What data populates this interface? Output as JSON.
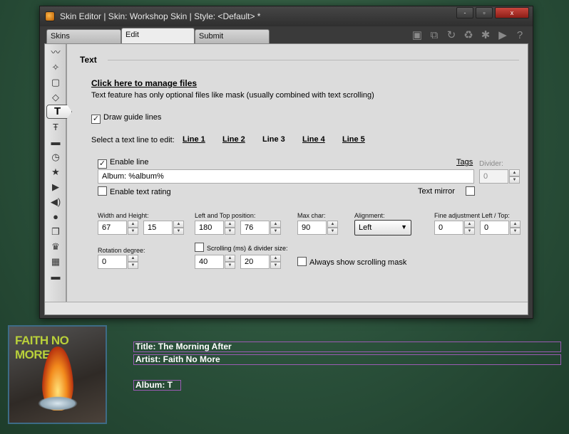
{
  "window": {
    "title": "Skin Editor | Skin: Workshop Skin | Style: <Default> *",
    "min_label": "-",
    "max_label": "▫",
    "close_label": "x"
  },
  "tabs": [
    {
      "label": "Skins"
    },
    {
      "label": "Edit"
    },
    {
      "label": "Submit"
    }
  ],
  "toolbar_icons": [
    "save-icon",
    "copy-icon",
    "redo-icon",
    "recycle-icon",
    "asterisk-icon",
    "play-icon",
    "help-icon"
  ],
  "sidebar_icons": [
    "mustache-icon",
    "star-shape-icon",
    "rectangle-icon",
    "diamond-icon",
    "text-icon",
    "text-scroll-icon",
    "bar-icon",
    "clock-icon",
    "star-icon",
    "play-icon",
    "speaker-icon",
    "speech-bubble-icon",
    "layers-icon",
    "crown-icon",
    "grid-icon",
    "line-icon"
  ],
  "section": {
    "title": "Text",
    "manage_link": "Click here to manage files",
    "description": "Text feature has only optional files like mask (usually combined with text scrolling)",
    "draw_guide_label": "Draw guide lines",
    "select_line_label": "Select a text line to edit:",
    "lines": [
      "Line 1",
      "Line 2",
      "Line 3",
      "Line 4",
      "Line 5"
    ],
    "enable_line_label": "Enable line",
    "tags_label": "Tags",
    "divider_label": "Divider:",
    "divider_value": "0",
    "text_value": "Album: %album%",
    "enable_rating_label": "Enable text rating",
    "text_mirror_label": "Text mirror",
    "width_height_label": "Width and Height:",
    "width_value": "67",
    "height_value": "15",
    "position_label": "Left and Top position:",
    "left_value": "180",
    "top_value": "76",
    "max_char_label": "Max char:",
    "max_char_value": "90",
    "alignment_label": "Alignment:",
    "alignment_value": "Left",
    "fine_adjust_label": "Fine adjustment Left / Top:",
    "fine_left_value": "0",
    "fine_top_value": "0",
    "rotation_label": "Rotation degree:",
    "rotation_value": "0",
    "scrolling_label": "Scrolling (ms) & divider size:",
    "scroll_ms_value": "40",
    "scroll_divider_value": "20",
    "always_scroll_label": "Always show scrolling mask"
  },
  "player": {
    "album_art_text": "FAITH NO MORE",
    "title_line": "Title: The Morning After",
    "artist_line": "Artist: Faith No More",
    "album_line": "Album: T"
  },
  "colors": {
    "background": "#2a503a",
    "text_outline": "#9b5bb4",
    "close_button": "#c9463d"
  }
}
